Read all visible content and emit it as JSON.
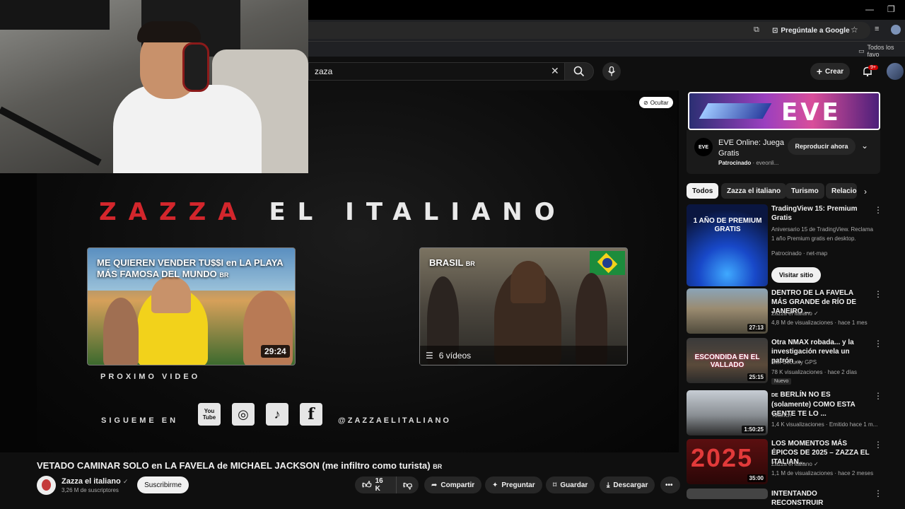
{
  "browser": {
    "ask_google": "Pregúntale a Google",
    "bookmarks_folder": "Todos los favo",
    "minimize": "—",
    "restore": "❐"
  },
  "yt_header": {
    "search_value": "zaza",
    "create_label": "Crear",
    "notifications_badge": "9+"
  },
  "player": {
    "hide_label": "Ocultar",
    "endcard_title_red": "ZAZZA",
    "endcard_title_white": "EL ITALIANO",
    "card1_title": "ME QUIEREN VENDER TU$$I en LA PLAYA MÁS FAMOSA DEL MUNDO",
    "card1_duration": "29:24",
    "card2_title": "BRASIL",
    "card2_videos": "6 vídeos",
    "br_badge": "BR",
    "next_video_label": "PROXIMO VIDEO",
    "follow_label": "SIGUEME EN",
    "handle": "@ZAZZAELITALIANO",
    "social": [
      "You Tube",
      "◎",
      "♪",
      "f"
    ]
  },
  "video": {
    "title": "VETADO CAMINAR SOLO en LA FAVELA de MICHAEL JACKSON (me infiltro como turista)",
    "title_badge": "BR",
    "channel_name": "Zazza el italiano",
    "subscribers": "3,26 M de suscriptores",
    "subscribe_label": "Suscribirme",
    "likes": "16 K",
    "share_label": "Compartir",
    "ask_label": "Preguntar",
    "save_label": "Guardar",
    "download_label": "Descargar"
  },
  "ad": {
    "logo_text": "EVE",
    "title": "EVE Online: Juega Gratis",
    "sponsored": "Patrocinado",
    "domain": "eveonli...",
    "cta": "Reproducir ahora",
    "icon_text": "EVE"
  },
  "chips": [
    "Todos",
    "Zazza el italiano",
    "Turismo",
    "Relacio"
  ],
  "recommendations": [
    {
      "title": "TradingView 15: Premium Gratis",
      "line1": "Aniversario 15 de TradingView. Reclama 1 año Premium gratis en desktop.",
      "line2": "Patrocinado · net-map",
      "thumb_text": "1 AÑO DE PREMIUM GRATIS",
      "cta": "Visitar sitio"
    },
    {
      "title": "DENTRO DE LA FAVELA MÁS GRANDE de RÍO DE JANEIRO ...",
      "channel": "Zazza el italiano",
      "meta": "4,8 M de visualizaciones · hace 1 mes",
      "duration": "27:13"
    },
    {
      "title": "Otra NMAX robada... y la investigación revela un patrón ...",
      "channel": "Self Security GPS",
      "meta": "78 K visualizaciones · hace 2 días",
      "duration": "25:15",
      "badge": "Nuevo",
      "thumb_text": "ESCONDIDA EN EL VALLADO"
    },
    {
      "title": "BERLÍN NO ES (solamente) COMO ESTA GENTE TE LO ...",
      "flag_prefix": "DE",
      "channel": "Totonch",
      "meta": "1,4 K visualizaciones · Emitido hace 1 m...",
      "duration": "1:50:25"
    },
    {
      "title": "LOS MOMENTOS MÁS ÉPICOS DE 2025 – ZAZZA EL ITALIAN...",
      "channel": "Zazza el italiano",
      "meta": "1,1 M de visualizaciones · hace 2 meses",
      "duration": "35:00",
      "thumb_text": "2025"
    },
    {
      "title": "INTENTANDO RECONSTRUIR"
    }
  ],
  "colors": {
    "brand_red": "#d3262c",
    "background": "#0f0f0f",
    "chip_bg": "#272727"
  }
}
